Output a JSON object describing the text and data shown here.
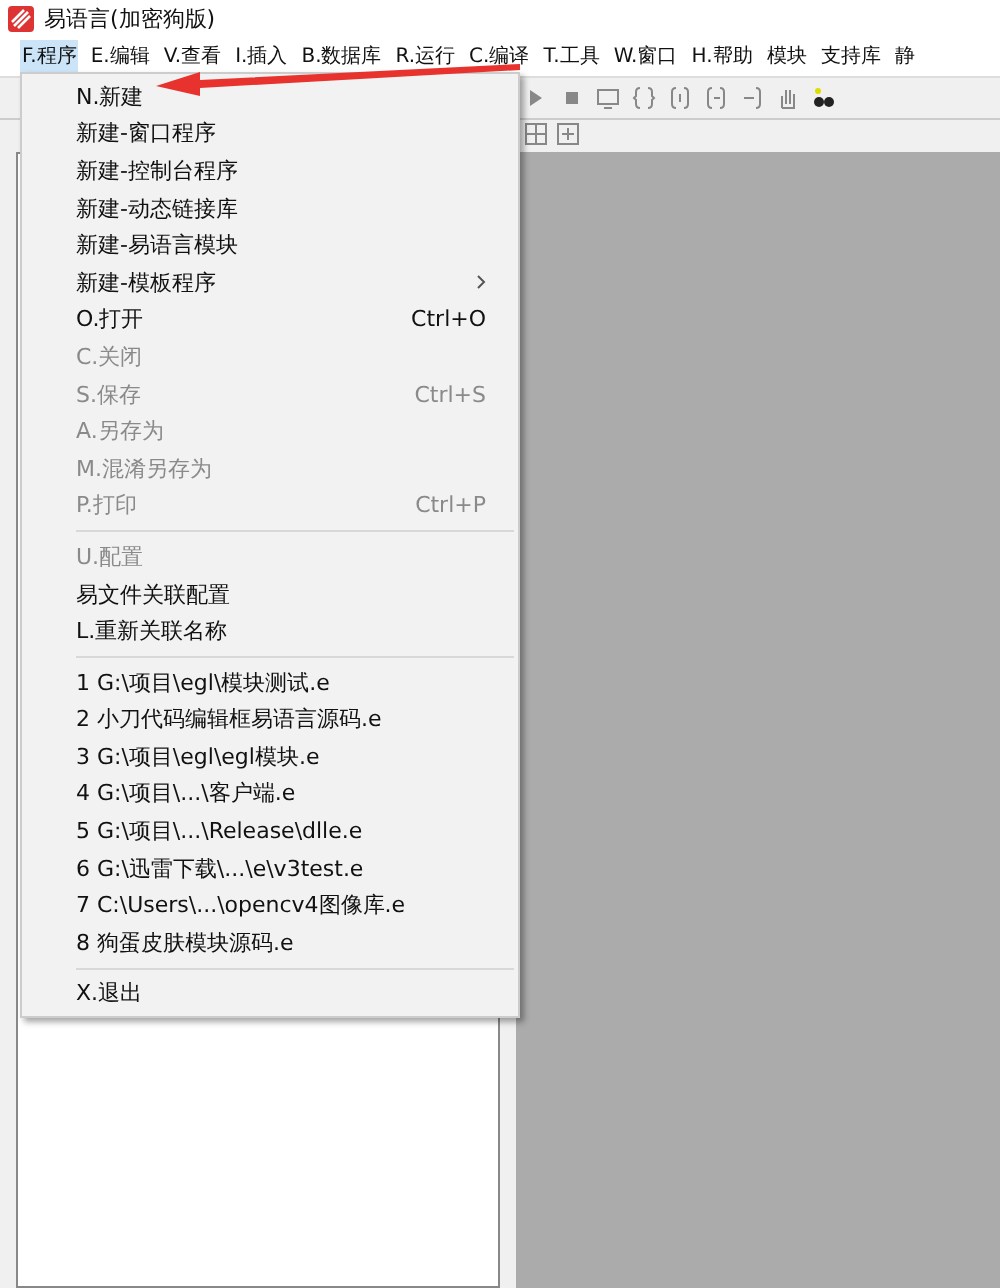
{
  "window": {
    "title": "易语言(加密狗版)"
  },
  "menubar": [
    {
      "label": "F.程序",
      "selected": true
    },
    {
      "label": "E.编辑",
      "selected": false
    },
    {
      "label": "V.查看",
      "selected": false
    },
    {
      "label": "I.插入",
      "selected": false
    },
    {
      "label": "B.数据库",
      "selected": false
    },
    {
      "label": "R.运行",
      "selected": false
    },
    {
      "label": "C.编译",
      "selected": false
    },
    {
      "label": "T.工具",
      "selected": false
    },
    {
      "label": "W.窗口",
      "selected": false
    },
    {
      "label": "H.帮助",
      "selected": false
    },
    {
      "label": "模块",
      "selected": false
    },
    {
      "label": "支持库",
      "selected": false
    },
    {
      "label": "静",
      "selected": false
    }
  ],
  "menu": [
    {
      "kind": "item",
      "label": "N.新建",
      "disabled": false
    },
    {
      "kind": "item",
      "label": "新建-窗口程序",
      "disabled": false
    },
    {
      "kind": "item",
      "label": "新建-控制台程序",
      "disabled": false
    },
    {
      "kind": "item",
      "label": "新建-动态链接库",
      "disabled": false
    },
    {
      "kind": "item",
      "label": "新建-易语言模块",
      "disabled": false
    },
    {
      "kind": "submenu",
      "label": "新建-模板程序",
      "disabled": false
    },
    {
      "kind": "item",
      "label": "O.打开",
      "shortcut": "Ctrl+O",
      "disabled": false
    },
    {
      "kind": "item",
      "label": "C.关闭",
      "disabled": true
    },
    {
      "kind": "item",
      "label": "S.保存",
      "shortcut": "Ctrl+S",
      "disabled": true
    },
    {
      "kind": "item",
      "label": "A.另存为",
      "disabled": true
    },
    {
      "kind": "item",
      "label": "M.混淆另存为",
      "disabled": true
    },
    {
      "kind": "item",
      "label": "P.打印",
      "shortcut": "Ctrl+P",
      "disabled": true
    },
    {
      "kind": "separator"
    },
    {
      "kind": "item",
      "label": "U.配置",
      "disabled": true
    },
    {
      "kind": "item",
      "label": "易文件关联配置",
      "disabled": false
    },
    {
      "kind": "item",
      "label": "L.重新关联名称",
      "disabled": false
    },
    {
      "kind": "separator"
    },
    {
      "kind": "item",
      "label": "1 G:\\项目\\egl\\模块测试.e",
      "disabled": false
    },
    {
      "kind": "item",
      "label": "2 小刀代码编辑框易语言源码.e",
      "disabled": false
    },
    {
      "kind": "item",
      "label": "3 G:\\项目\\egl\\egl模块.e",
      "disabled": false
    },
    {
      "kind": "item",
      "label": "4 G:\\项目\\...\\客户端.e",
      "disabled": false
    },
    {
      "kind": "item",
      "label": "5 G:\\项目\\...\\Release\\dlle.e",
      "disabled": false
    },
    {
      "kind": "item",
      "label": "6 G:\\迅雷下载\\...\\e\\v3test.e",
      "disabled": false
    },
    {
      "kind": "item",
      "label": "7 C:\\Users\\...\\opencv4图像库.e",
      "disabled": false
    },
    {
      "kind": "item",
      "label": "8 狗蛋皮肤模块源码.e",
      "disabled": false
    },
    {
      "kind": "separator"
    },
    {
      "kind": "item",
      "label": "X.退出",
      "disabled": false
    }
  ]
}
